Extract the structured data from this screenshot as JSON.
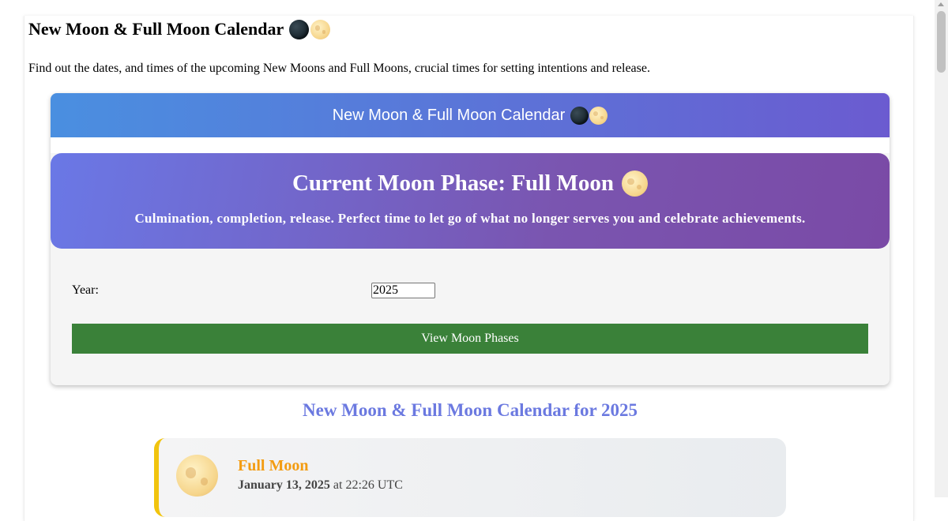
{
  "page": {
    "title": "New Moon & Full Moon Calendar",
    "intro": "Find out the dates, and times of the upcoming New Moons and Full Moons, crucial times for setting intentions and release."
  },
  "widget": {
    "header": "New Moon & Full Moon Calendar",
    "current_phase": {
      "title": "Current Moon Phase: Full Moon",
      "description": "Culmination, completion, release. Perfect time to let go of what no longer serves you and celebrate achievements."
    },
    "year_label": "Year:",
    "year_value": "2025",
    "button_label": "View Moon Phases"
  },
  "calendar": {
    "heading": "New Moon & Full Moon Calendar for 2025",
    "events": [
      {
        "type": "Full Moon",
        "date": "January 13, 2025",
        "time_text": "at 22:26 UTC"
      }
    ]
  },
  "colors": {
    "header_gradient_start": "#4a8fe0",
    "header_gradient_end": "#6b5bd0",
    "button": "#3a8139",
    "calendar_heading": "#6b79e0",
    "full_moon_title": "#f39c12",
    "event_accent": "#f1c40f"
  },
  "icons": [
    "new-moon-icon",
    "full-moon-icon"
  ]
}
